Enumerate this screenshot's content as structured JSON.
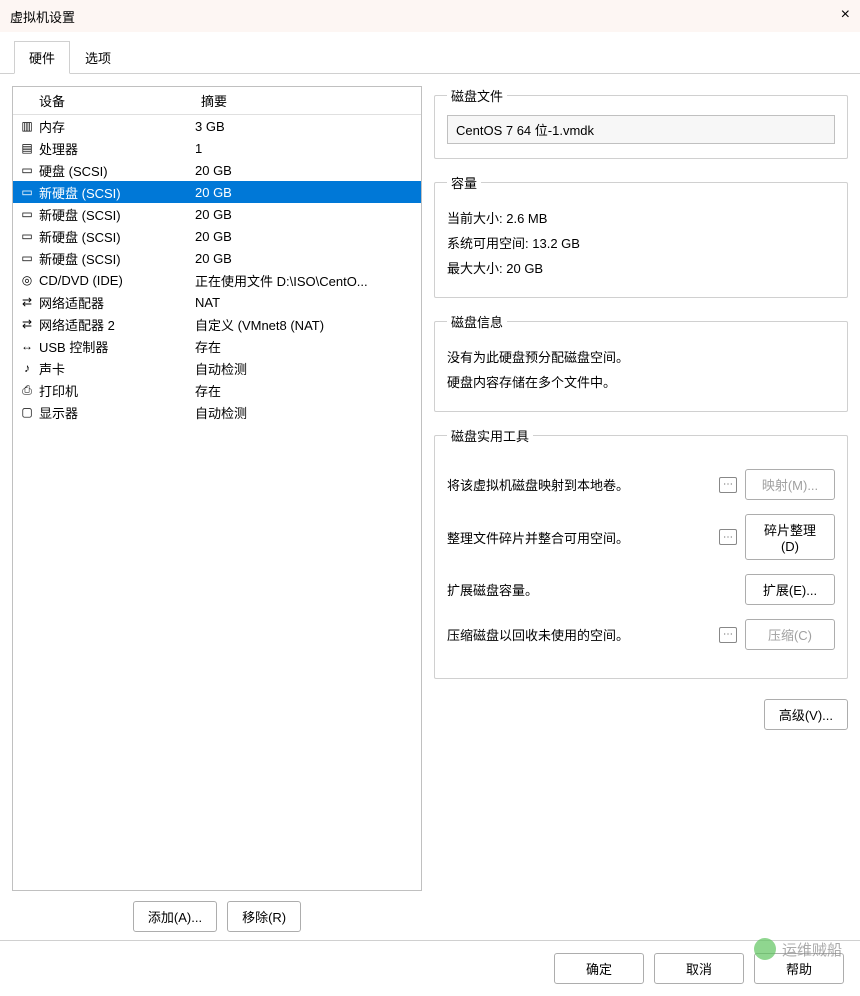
{
  "window": {
    "title": "虚拟机设置",
    "close": "×"
  },
  "tabs": {
    "hardware": "硬件",
    "options": "选项"
  },
  "headers": {
    "device": "设备",
    "summary": "摘要"
  },
  "devices": [
    {
      "icon": "▥",
      "iname": "memory-icon",
      "name": "内存",
      "summary": "3 GB"
    },
    {
      "icon": "▤",
      "iname": "cpu-icon",
      "name": "处理器",
      "summary": "1"
    },
    {
      "icon": "▭",
      "iname": "disk-icon",
      "name": "硬盘 (SCSI)",
      "summary": "20 GB"
    },
    {
      "icon": "▭",
      "iname": "disk-icon",
      "name": "新硬盘 (SCSI)",
      "summary": "20 GB",
      "selected": true
    },
    {
      "icon": "▭",
      "iname": "disk-icon",
      "name": "新硬盘 (SCSI)",
      "summary": "20 GB"
    },
    {
      "icon": "▭",
      "iname": "disk-icon",
      "name": "新硬盘 (SCSI)",
      "summary": "20 GB"
    },
    {
      "icon": "▭",
      "iname": "disk-icon",
      "name": "新硬盘 (SCSI)",
      "summary": "20 GB"
    },
    {
      "icon": "◎",
      "iname": "cd-icon",
      "name": "CD/DVD (IDE)",
      "summary": "正在使用文件 D:\\ISO\\CentO..."
    },
    {
      "icon": "�ival",
      "iname": "network-icon",
      "name": "网络适配器",
      "summary": "NAT"
    },
    {
      "icon": "�ival",
      "iname": "network-icon",
      "name": "网络适配器 2",
      "summary": "自定义 (VMnet8 (NAT)"
    },
    {
      "icon": "↔",
      "iname": "usb-icon",
      "name": "USB 控制器",
      "summary": "存在"
    },
    {
      "icon": "🔈",
      "iname": "sound-icon",
      "name": "声卡",
      "summary": "自动检测"
    },
    {
      "icon": "⎙",
      "iname": "printer-icon",
      "name": "打印机",
      "summary": "存在"
    },
    {
      "icon": "▢",
      "iname": "display-icon",
      "name": "显示器",
      "summary": "自动检测"
    }
  ],
  "leftbtn": {
    "add": "添加(A)...",
    "remove": "移除(R)"
  },
  "disk_file": {
    "legend": "磁盘文件",
    "value": "CentOS 7 64 位-1.vmdk"
  },
  "capacity": {
    "legend": "容量",
    "current_label": "当前大小:",
    "current_value": "2.6 MB",
    "free_label": "系统可用空间:",
    "free_value": "13.2 GB",
    "max_label": "最大大小:",
    "max_value": "20 GB"
  },
  "disk_info": {
    "legend": "磁盘信息",
    "line1": "没有为此硬盘预分配磁盘空间。",
    "line2": "硬盘内容存储在多个文件中。"
  },
  "utilities": {
    "legend": "磁盘实用工具",
    "map_text": "将该虚拟机磁盘映射到本地卷。",
    "map_btn": "映射(M)...",
    "defrag_text": "整理文件碎片并整合可用空间。",
    "defrag_btn": "碎片整理(D)",
    "expand_text": "扩展磁盘容量。",
    "expand_btn": "扩展(E)...",
    "compact_text": "压缩磁盘以回收未使用的空间。",
    "compact_btn": "压缩(C)"
  },
  "advanced_btn": "高级(V)...",
  "bottom": {
    "ok": "确定",
    "cancel": "取消",
    "help": "帮助"
  },
  "watermark": "运维贼船",
  "hint_glyph": "⋯"
}
